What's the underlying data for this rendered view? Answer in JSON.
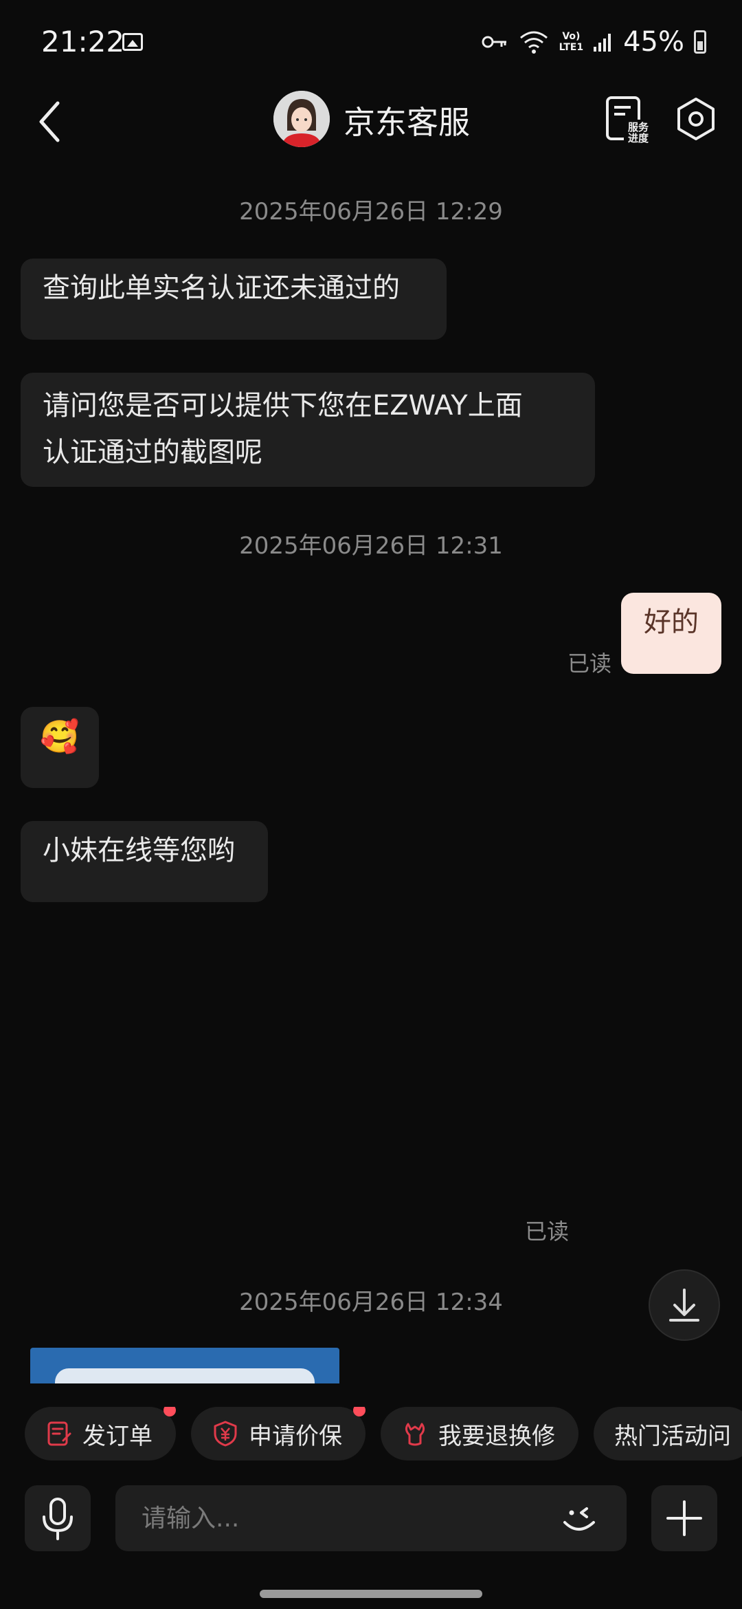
{
  "status_bar": {
    "time": "21:22",
    "battery": "45%",
    "icons": [
      "image-icon",
      "key-icon",
      "wifi-icon",
      "volte-icon",
      "signal-icon",
      "battery-icon"
    ],
    "volte_line1": "Vo)",
    "volte_line2": "LTE1"
  },
  "header": {
    "title": "京东客服",
    "service_line1": "服务",
    "service_line2": "进度"
  },
  "messages": {
    "ts1": "2025年06月26日 12:29",
    "m1": "查询此单实名认证还未通过的",
    "m2_line1": "请问您是否可以提供下您在EZWAY上面",
    "m2_line2": "认证通过的截图呢",
    "ts2": "2025年06月26日 12:31",
    "m3": "好的",
    "read1": "已读",
    "m4_emoji": "🥰",
    "m5": "小妹在线等您哟",
    "read2": "已读",
    "ts3": "2025年06月26日 12:34"
  },
  "chips": [
    {
      "label": "发订单",
      "icon": "order-icon",
      "dot": true
    },
    {
      "label": "申请价保",
      "icon": "price-protect-icon",
      "dot": true
    },
    {
      "label": "我要退换修",
      "icon": "repair-icon",
      "dot": false
    },
    {
      "label": "热门活动问",
      "icon": "",
      "dot": false
    }
  ],
  "input": {
    "placeholder": "请输入..."
  },
  "colors": {
    "background": "#0b0b0b",
    "bubble_received": "#1f1f1f",
    "bubble_sent": "#fbe6df",
    "accent_red": "#e03a4a"
  }
}
